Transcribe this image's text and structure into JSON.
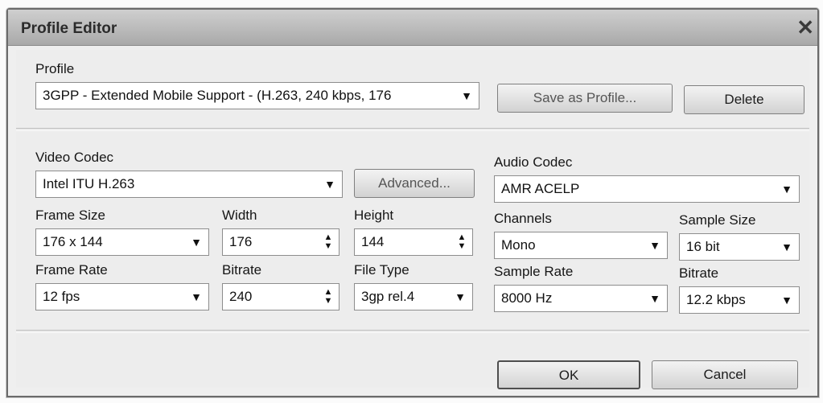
{
  "window": {
    "title": "Profile Editor",
    "close_glyph": "✕"
  },
  "profile": {
    "label": "Profile",
    "value": "3GPP - Extended Mobile Support - (H.263, 240 kbps, 176",
    "save_button": "Save as Profile...",
    "delete_button": "Delete"
  },
  "video": {
    "codec_label": "Video Codec",
    "codec_value": "Intel ITU H.263",
    "advanced_button": "Advanced...",
    "frame_size_label": "Frame Size",
    "frame_size_value": "176 x 144",
    "width_label": "Width",
    "width_value": "176",
    "height_label": "Height",
    "height_value": "144",
    "frame_rate_label": "Frame Rate",
    "frame_rate_value": "12 fps",
    "bitrate_label": "Bitrate",
    "bitrate_value": "240",
    "file_type_label": "File Type",
    "file_type_value": "3gp rel.4"
  },
  "audio": {
    "codec_label": "Audio Codec",
    "codec_value": "AMR ACELP",
    "channels_label": "Channels",
    "channels_value": "Mono",
    "sample_size_label": "Sample Size",
    "sample_size_value": "16 bit",
    "sample_rate_label": "Sample Rate",
    "sample_rate_value": "8000 Hz",
    "bitrate_label": "Bitrate",
    "bitrate_value": "12.2 kbps"
  },
  "footer": {
    "ok_button": "OK",
    "cancel_button": "Cancel"
  },
  "icons": {
    "dropdown": "▼",
    "spin_up": "▲",
    "spin_down": "▼"
  }
}
